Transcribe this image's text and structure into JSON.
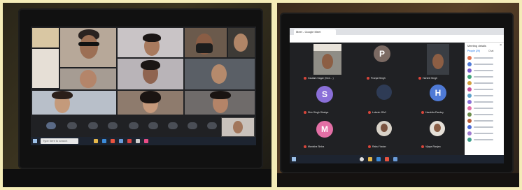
{
  "photo_left": {
    "taskbar": {
      "search_text": "Type here to search"
    },
    "tiles": 12
  },
  "photo_right": {
    "header": {
      "app_title": "Meet - Google Meet"
    },
    "participants_panel": {
      "title": "Meeting details",
      "tab_people": "People (29)",
      "tab_chat": "Chat"
    },
    "tiles": [
      {
        "label": "Gautam Sagar (Vice... )",
        "initial": ""
      },
      {
        "label": "Pranjal Singh",
        "initial": "P",
        "color": "#7b6a63"
      },
      {
        "label": "Harshit Singh",
        "initial": ""
      },
      {
        "label": "Shiv Singh Shakya",
        "initial": "S",
        "color": "#8a6fd8"
      },
      {
        "label": "Lokesh JNVI",
        "initial": ""
      },
      {
        "label": "Harshita Pandey",
        "initial": "H",
        "color": "#4f7ad6"
      },
      {
        "label": "Manisha Sinha",
        "initial": "M",
        "color": "#e36fa5"
      },
      {
        "label": "Rahul Yadav",
        "initial": ""
      },
      {
        "label": "Vijaya Ranjan",
        "initial": ""
      }
    ],
    "participant_colors": [
      "#e0704d",
      "#4f7ad6",
      "#7c5ccc",
      "#40a47a",
      "#d2a03b",
      "#c64f9a",
      "#5aa0c9",
      "#8a6fd8",
      "#e36fa5",
      "#6a8c4a",
      "#b85c3a",
      "#4a6ad6",
      "#a07ad0",
      "#3f9e8c"
    ]
  }
}
